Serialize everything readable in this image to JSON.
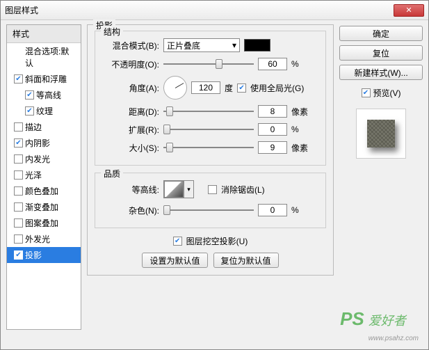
{
  "dialog": {
    "title": "图层样式"
  },
  "left": {
    "header": "样式",
    "blending_defaults": "混合选项:默认",
    "items": [
      {
        "label": "斜面和浮雕",
        "checked": true
      },
      {
        "label": "等高线",
        "checked": true,
        "sub": true
      },
      {
        "label": "纹理",
        "checked": true,
        "sub": true
      },
      {
        "label": "描边",
        "checked": false
      },
      {
        "label": "内阴影",
        "checked": true
      },
      {
        "label": "内发光",
        "checked": false
      },
      {
        "label": "光泽",
        "checked": false
      },
      {
        "label": "颜色叠加",
        "checked": false
      },
      {
        "label": "渐变叠加",
        "checked": false
      },
      {
        "label": "图案叠加",
        "checked": false
      },
      {
        "label": "外发光",
        "checked": false
      },
      {
        "label": "投影",
        "checked": true,
        "selected": true
      }
    ]
  },
  "middle": {
    "panel_title": "投影",
    "structure": {
      "title": "结构",
      "blend_mode_label": "混合模式(B):",
      "blend_mode_value": "正片叠底",
      "color": "#000000",
      "opacity_label": "不透明度(O):",
      "opacity_value": "60",
      "opacity_unit": "%",
      "angle_label": "角度(A):",
      "angle_value": "120",
      "angle_unit": "度",
      "global_light_label": "使用全局光(G)",
      "global_light_checked": true,
      "distance_label": "距离(D):",
      "distance_value": "8",
      "distance_unit": "像素",
      "spread_label": "扩展(R):",
      "spread_value": "0",
      "spread_unit": "%",
      "size_label": "大小(S):",
      "size_value": "9",
      "size_unit": "像素"
    },
    "quality": {
      "title": "品质",
      "contour_label": "等高线:",
      "antialias_label": "消除锯齿(L)",
      "antialias_checked": false,
      "noise_label": "杂色(N):",
      "noise_value": "0",
      "noise_unit": "%"
    },
    "knockout_label": "图层挖空投影(U)",
    "knockout_checked": true,
    "buttons": {
      "default": "设置为默认值",
      "reset": "复位为默认值"
    }
  },
  "right": {
    "ok": "确定",
    "reset": "复位",
    "new_style": "新建样式(W)...",
    "preview_label": "预览(V)",
    "preview_checked": true
  },
  "watermark": {
    "logo": "PS",
    "text": "爱好者",
    "url": "www.psahz.com"
  }
}
